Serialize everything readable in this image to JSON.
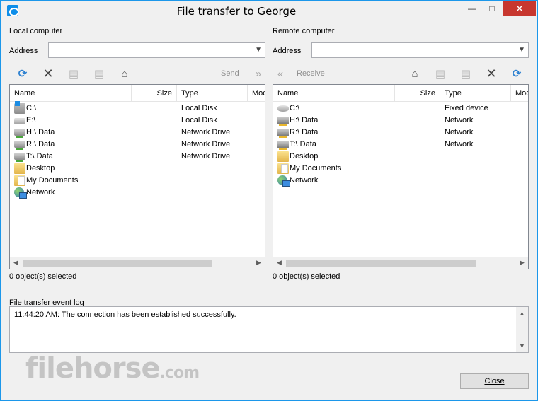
{
  "window": {
    "title": "File transfer to George",
    "minimize": "—",
    "maximize": "□",
    "close": "✕"
  },
  "local": {
    "heading": "Local computer",
    "address_label": "Address",
    "address_value": "",
    "send_label": "Send",
    "columns": [
      "Name",
      "Size",
      "Type",
      "Moc"
    ],
    "items": [
      {
        "name": "C:\\",
        "type": "Local Disk",
        "icon": "windows-drive-icon"
      },
      {
        "name": "E:\\",
        "type": "Local Disk",
        "icon": "drive-icon"
      },
      {
        "name": "H:\\ Data",
        "type": "Network Drive",
        "icon": "network-drive-icon"
      },
      {
        "name": "R:\\ Data",
        "type": "Network Drive",
        "icon": "network-drive-icon"
      },
      {
        "name": "T:\\ Data",
        "type": "Network Drive",
        "icon": "network-drive-icon"
      },
      {
        "name": "Desktop",
        "type": "",
        "icon": "folder-icon"
      },
      {
        "name": "My Documents",
        "type": "",
        "icon": "documents-folder-icon"
      },
      {
        "name": "Network",
        "type": "",
        "icon": "network-globe-icon"
      }
    ],
    "status": "0 object(s) selected"
  },
  "remote": {
    "heading": "Remote computer",
    "address_label": "Address",
    "address_value": "",
    "receive_label": "Receive",
    "columns": [
      "Name",
      "Size",
      "Type",
      "Moc"
    ],
    "items": [
      {
        "name": "C:\\",
        "type": "Fixed device",
        "icon": "fixed-drive-icon"
      },
      {
        "name": "H:\\ Data",
        "type": "Network",
        "icon": "network-drive-icon"
      },
      {
        "name": "R:\\ Data",
        "type": "Network",
        "icon": "network-drive-icon"
      },
      {
        "name": "T:\\ Data",
        "type": "Network",
        "icon": "network-drive-icon"
      },
      {
        "name": "Desktop",
        "type": "",
        "icon": "folder-icon"
      },
      {
        "name": "My Documents",
        "type": "",
        "icon": "documents-folder-icon"
      },
      {
        "name": "Network",
        "type": "",
        "icon": "network-globe-icon"
      }
    ],
    "status": "0 object(s) selected"
  },
  "log": {
    "label": "File transfer event log",
    "entries": [
      "11:44:20 AM: The connection has been established successfully."
    ]
  },
  "close_button": "Close",
  "watermark": {
    "main": "filehorse",
    "suffix": ".com"
  }
}
